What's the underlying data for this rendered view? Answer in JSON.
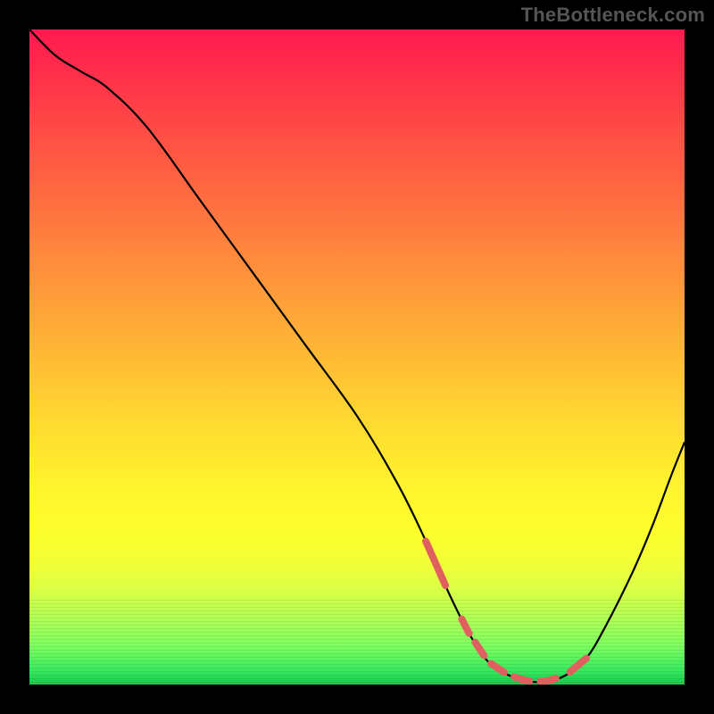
{
  "watermark": "TheBottleneck.com",
  "colors": {
    "curve": "#000000",
    "highlight": "#e06060",
    "frame": "#000000"
  },
  "chart_data": {
    "type": "line",
    "title": "",
    "xlabel": "",
    "ylabel": "",
    "xlim": [
      0,
      100
    ],
    "ylim": [
      0,
      100
    ],
    "series": [
      {
        "name": "bottleneck-curve",
        "x": [
          0,
          4,
          8,
          12,
          18,
          26,
          34,
          42,
          50,
          56,
          60,
          64,
          67,
          70,
          73,
          76,
          79,
          82,
          85,
          88,
          92,
          95,
          98,
          100
        ],
        "y": [
          100,
          96,
          93.5,
          91,
          85,
          74,
          63,
          52,
          41,
          31,
          23,
          14,
          8,
          3.5,
          1.5,
          0.5,
          0.5,
          1.5,
          4,
          9,
          17,
          24,
          32,
          37
        ]
      }
    ],
    "highlight": {
      "description": "optimal (low-bottleneck) region markers",
      "style": "coral-dashed",
      "segments": [
        {
          "x": [
            60.5,
            63.5
          ],
          "type": "solid"
        },
        {
          "x": [
            66.0,
            80.5
          ],
          "type": "dashed"
        },
        {
          "x": [
            82.5,
            85.0
          ],
          "type": "solid"
        }
      ]
    },
    "gradient_stops": [
      {
        "pct": 0,
        "color": "#ff1a4e"
      },
      {
        "pct": 50,
        "color": "#ffb735"
      },
      {
        "pct": 80,
        "color": "#f0ff3a"
      },
      {
        "pct": 100,
        "color": "#18c84a"
      }
    ]
  }
}
